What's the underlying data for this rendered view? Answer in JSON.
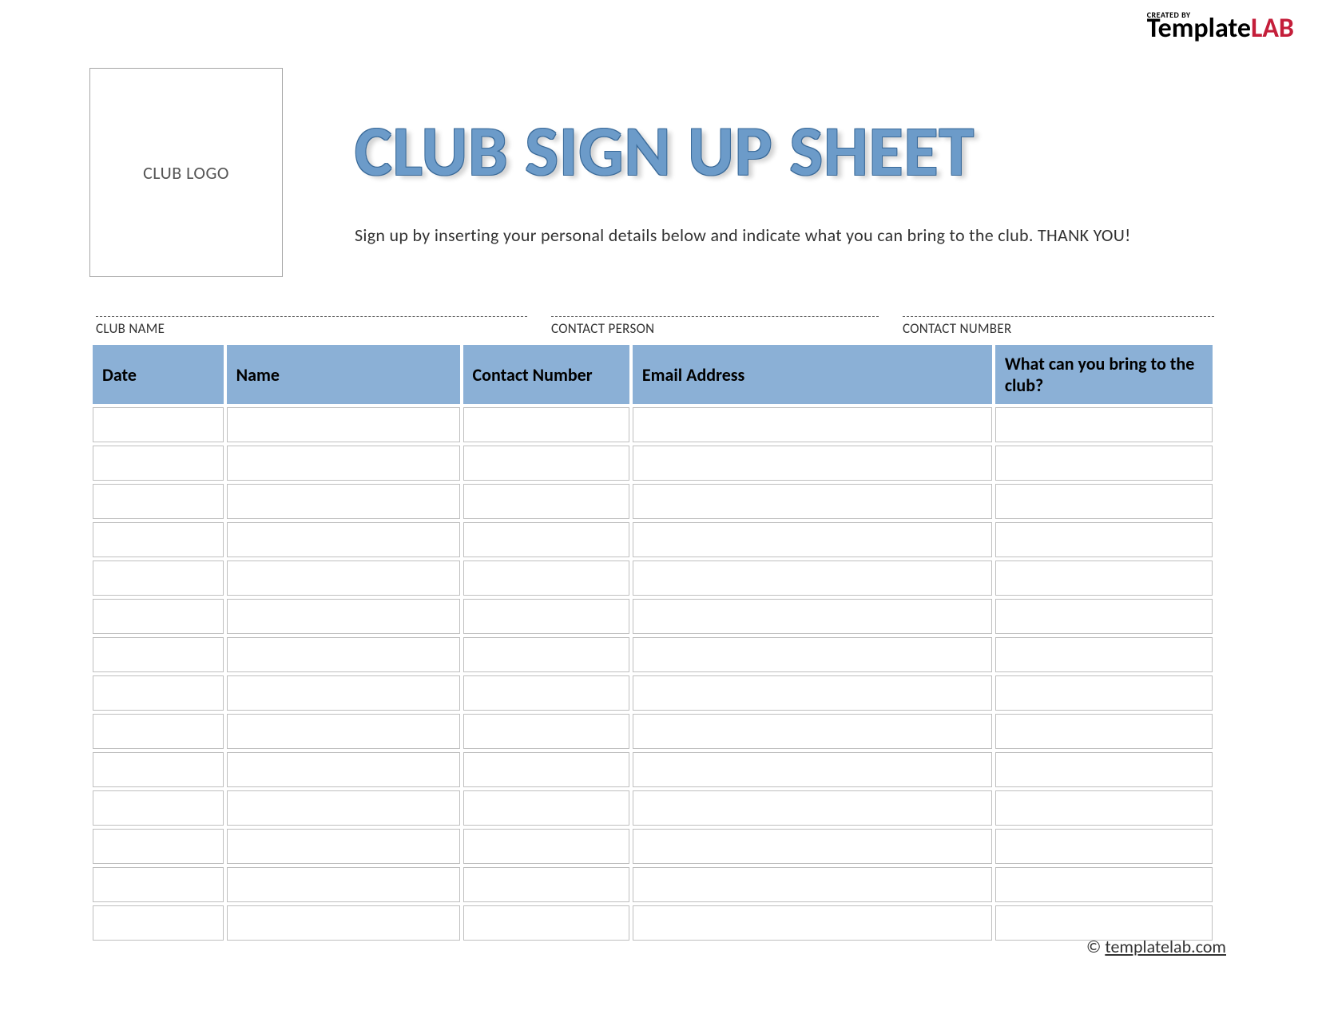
{
  "brand": {
    "created_by": "CREATED BY",
    "name_part1": "Template",
    "name_part2": "LAB"
  },
  "logo_placeholder": "CLUB LOGO",
  "title": "CLUB SIGN UP SHEET",
  "subtitle": "Sign up by inserting your personal details below and indicate what you can bring to the club. THANK YOU!",
  "info": {
    "club_name_label": "CLUB NAME",
    "contact_person_label": "CONTACT PERSON",
    "contact_number_label": "CONTACT NUMBER"
  },
  "table": {
    "headers": {
      "date": "Date",
      "name": "Name",
      "contact_number": "Contact Number",
      "email": "Email Address",
      "bring": "What can you bring to the club?"
    },
    "row_count": 14
  },
  "footer": {
    "copyright": "©",
    "link_text": "templatelab.com"
  }
}
